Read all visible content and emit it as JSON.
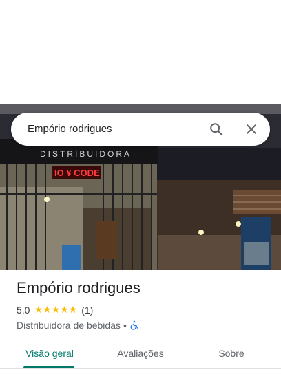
{
  "search": {
    "query": "Empório rodrigues"
  },
  "place": {
    "name": "Empório rodrigues",
    "rating": "5,0",
    "stars": "★★★★★",
    "review_count": "(1)",
    "category": "Distribuidora de bebidas",
    "separator": "•"
  },
  "photo": {
    "sign_text": "DISTRIBUIDORA",
    "neon_text": "IO ¥ CODE"
  },
  "tabs": [
    {
      "label": "Visão geral",
      "active": true
    },
    {
      "label": "Avaliações",
      "active": false
    },
    {
      "label": "Sobre",
      "active": false
    }
  ],
  "colors": {
    "accent": "#00796b",
    "star": "#fbbc04",
    "accessibility": "#1a73e8"
  },
  "icons": [
    "search-icon",
    "close-icon",
    "wheelchair-icon"
  ]
}
